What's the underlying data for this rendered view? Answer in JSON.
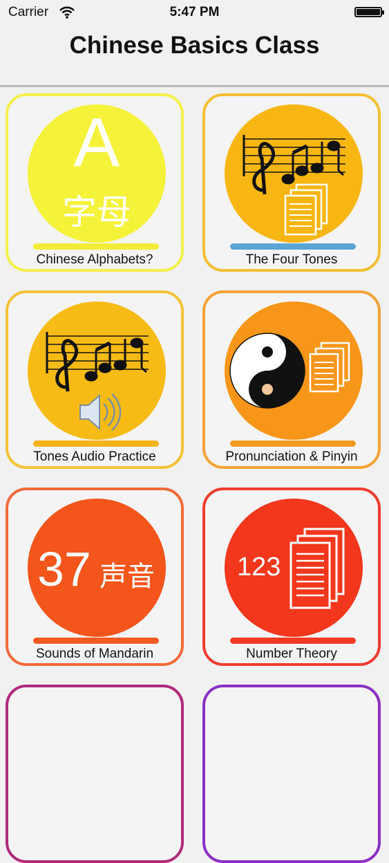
{
  "status_bar": {
    "carrier": "Carrier",
    "time": "5:47 PM"
  },
  "nav": {
    "title": "Chinese Basics Class"
  },
  "tiles": [
    {
      "label": "Chinese Alphabets?",
      "color": "#f3f04a",
      "circle_color": "#f5f23a",
      "bar_color": "#f2ec37",
      "glyph_letter": "A",
      "glyph_chars": "字母"
    },
    {
      "label": "The Four Tones",
      "color": "#f4bf32",
      "circle_color": "#f7b612",
      "bar_color": "#5aa4d6"
    },
    {
      "label": "Tones Audio Practice",
      "color": "#f4c236",
      "circle_color": "#f7bb15",
      "bar_color": "#f4b419"
    },
    {
      "label": "Pronunciation & Pinyin",
      "color": "#f4a235",
      "circle_color": "#f79618",
      "bar_color": "#f39b22"
    },
    {
      "label": "Sounds of Mandarin",
      "color": "#f26a3a",
      "circle_color": "#f3551b",
      "bar_color": "#f35a23",
      "glyph_number": "37",
      "glyph_chars": "声音"
    },
    {
      "label": "Number Theory",
      "color": "#ef3b2f",
      "circle_color": "#f2371d",
      "bar_color": "#f03a24",
      "glyph_number": "123"
    }
  ],
  "partial_tiles": [
    {
      "color": "#b02a7a"
    },
    {
      "color": "#8a2fc4"
    }
  ],
  "icons": {
    "status": [
      "wifi-icon",
      "battery-icon"
    ],
    "tile_icons": [
      "alphabet-icon",
      "music-notes-icon",
      "document-icon",
      "speaker-icon",
      "yin-yang-icon"
    ]
  }
}
